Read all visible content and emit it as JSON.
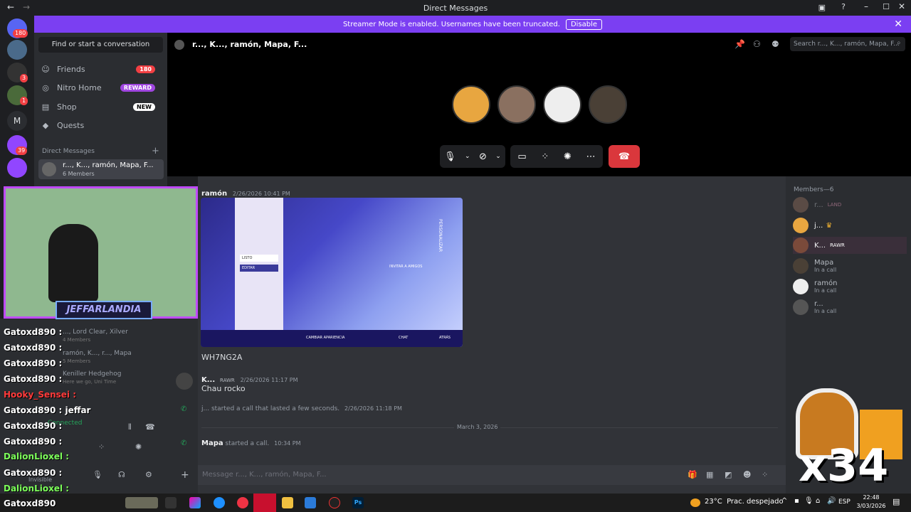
{
  "window": {
    "title": "Direct Messages"
  },
  "banner": {
    "text": "Streamer Mode is enabled. Usernames have been truncated.",
    "button": "Disable"
  },
  "servers": {
    "badges": [
      "180",
      "3",
      "1",
      "39"
    ],
    "letter": "M"
  },
  "dm_sidebar": {
    "search": "Find or start a conversation",
    "nav": [
      {
        "label": "Friends",
        "badge": "180"
      },
      {
        "label": "Nitro Home",
        "badge": "REWARD"
      },
      {
        "label": "Shop",
        "badge": "NEW"
      },
      {
        "label": "Quests",
        "badge": ""
      }
    ],
    "section_title": "Direct Messages",
    "active_dm": {
      "name": "r..., K..., ramón, Mapa, F...",
      "sub": "6 Members"
    }
  },
  "channel_header": {
    "title": "r..., K..., ramón, Mapa, F...",
    "search_placeholder": "Search r..., K..., ramón, Mapa, F..."
  },
  "messages": [
    {
      "author": "ramón",
      "time": "2/26/2026 10:41 PM"
    },
    {
      "text": "WH7NG2A"
    },
    {
      "author": "K...",
      "tag": "RAWR",
      "time": "2/26/2026 11:17 PM",
      "text": "Chau rocko"
    },
    {
      "system": "j... started a call that lasted a few seconds.",
      "time": "2/26/2026 11:18 PM"
    },
    {
      "divider": "March 3, 2026"
    },
    {
      "system_author": "Mapa",
      "system": "started a call.",
      "time": "10:34 PM"
    }
  ],
  "message_input": {
    "placeholder": "Message r..., K..., ramón, Mapa, F..."
  },
  "members": {
    "title": "Members—6",
    "list": [
      {
        "name": "r...",
        "tag": "LAND",
        "sub": ""
      },
      {
        "name": "j...",
        "tag": "",
        "sub": ""
      },
      {
        "name": "K...",
        "tag": "RAWR",
        "sub": ""
      },
      {
        "name": "Mapa",
        "tag": "",
        "sub": "In a call"
      },
      {
        "name": "ramón",
        "tag": "",
        "sub": "In a call"
      },
      {
        "name": "r...",
        "tag": "",
        "sub": "In a call"
      }
    ]
  },
  "embed_text": {
    "listo": "LISTO",
    "editar": "EDITAR",
    "invitar": "INVITAR A AMIGOS",
    "cambiar": "CAMBIAR APARIENCIA",
    "chat": "CHAT",
    "atras": "ATRÁS",
    "side": "PERSONALIZAR"
  },
  "stream_overlay": {
    "logo": "JEFFARLANDIA",
    "chat": [
      {
        "user": "Gatoxd890 :",
        "text": ""
      },
      {
        "user": "Gatoxd890 :",
        "text": ""
      },
      {
        "user": "Gatoxd890 :",
        "text": ""
      },
      {
        "user": "Gatoxd890 :",
        "text": ""
      },
      {
        "user": "Hooky_Sensei :",
        "text": ""
      },
      {
        "user": "Gatoxd890 :",
        "text": "jeffar"
      },
      {
        "user": "Gatoxd890 :",
        "text": ""
      },
      {
        "user": "Gatoxd890 :",
        "text": ""
      },
      {
        "user": "DalionLioxel :",
        "text": ""
      },
      {
        "user": "Gatoxd890 :",
        "text": ""
      },
      {
        "user": "DalionLioxel :",
        "text": ""
      },
      {
        "user": "Gatoxd890",
        "text": ""
      }
    ],
    "under_dm": [
      {
        "name": "..., Lord Clear, Xilver",
        "sub": "4 Members"
      },
      {
        "name": "ramón, K..., r..., Mapa",
        "sub": "5 Members"
      },
      {
        "name": "Keniller Hedgehog",
        "sub": "Here we go, Uni Time"
      }
    ],
    "connected": "Connected",
    "invisible": "Invisible",
    "combo": "x34"
  },
  "taskbar": {
    "weather": "23°C  Prac. despejado",
    "lang": "ESP",
    "time": "22:48",
    "date": "3/03/2026"
  },
  "colors": {
    "accent": "#7b3ff2",
    "danger": "#da373c",
    "online": "#23a55a"
  }
}
